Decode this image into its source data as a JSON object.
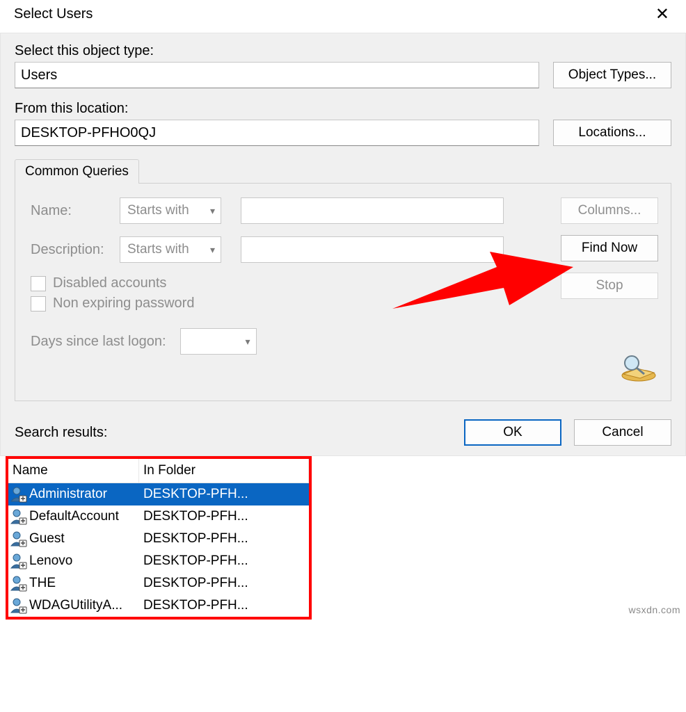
{
  "dialog": {
    "title": "Select Users"
  },
  "section1": {
    "object_type_label": "Select this object type:",
    "object_type_value": "Users",
    "object_types_btn": "Object Types...",
    "location_label": "From this location:",
    "location_value": "DESKTOP-PFHO0QJ",
    "locations_btn": "Locations..."
  },
  "queries": {
    "tab_label": "Common Queries",
    "name_label": "Name:",
    "name_mode": "Starts with",
    "desc_label": "Description:",
    "desc_mode": "Starts with",
    "chk_disabled": "Disabled accounts",
    "chk_nonexp": "Non expiring password",
    "days_label": "Days since last logon:",
    "columns_btn": "Columns...",
    "findnow_btn": "Find Now",
    "stop_btn": "Stop"
  },
  "footer": {
    "ok": "OK",
    "cancel": "Cancel",
    "results_label": "Search results:"
  },
  "results": {
    "headers": {
      "name": "Name",
      "folder": "In Folder"
    },
    "rows": [
      {
        "name": "Administrator",
        "folder": "DESKTOP-PFH...",
        "selected": true
      },
      {
        "name": "DefaultAccount",
        "folder": "DESKTOP-PFH...",
        "selected": false
      },
      {
        "name": "Guest",
        "folder": "DESKTOP-PFH...",
        "selected": false
      },
      {
        "name": "Lenovo",
        "folder": "DESKTOP-PFH...",
        "selected": false
      },
      {
        "name": "THE",
        "folder": "DESKTOP-PFH...",
        "selected": false
      },
      {
        "name": "WDAGUtilityA...",
        "folder": "DESKTOP-PFH...",
        "selected": false
      }
    ]
  },
  "watermark": "wsxdn.com"
}
